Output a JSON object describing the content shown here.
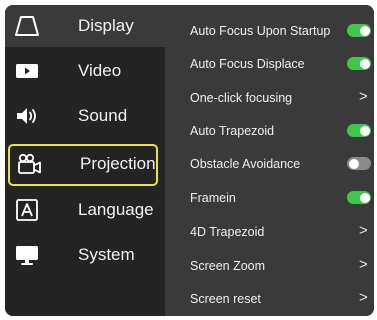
{
  "sidebar": {
    "items": [
      {
        "label": "Display",
        "icon": "trapezoid-icon",
        "selected": true
      },
      {
        "label": "Video",
        "icon": "video-icon"
      },
      {
        "label": "Sound",
        "icon": "speaker-icon"
      },
      {
        "label": "Projection",
        "icon": "projector-icon",
        "focused": true
      },
      {
        "label": "Language",
        "icon": "language-a-icon"
      },
      {
        "label": "System",
        "icon": "monitor-icon"
      }
    ]
  },
  "settings": {
    "rows": [
      {
        "label": "Auto Focus Upon Startup",
        "control": "toggle",
        "on": true
      },
      {
        "label": "Auto Focus Displace",
        "control": "toggle",
        "on": true
      },
      {
        "label": "One-click focusing",
        "control": "chevron",
        "glyph": ">"
      },
      {
        "label": "Auto Trapezoid",
        "control": "toggle",
        "on": true
      },
      {
        "label": "Obstacle Avoidance",
        "control": "toggle",
        "on": false
      },
      {
        "label": "Framein",
        "control": "toggle",
        "on": true
      },
      {
        "label": "4D Trapezoid",
        "control": "chevron",
        "glyph": ">"
      },
      {
        "label": "Screen Zoom",
        "control": "chevron",
        "glyph": ">"
      },
      {
        "label": "Screen reset",
        "control": "chevron",
        "glyph": ">"
      }
    ]
  },
  "colors": {
    "toggle_on": "#3ec64d",
    "toggle_off": "#8a8a8a",
    "focus_outline": "#e9e53a",
    "sidebar_bg": "#242424",
    "panel_bg": "#3a3a3a"
  }
}
